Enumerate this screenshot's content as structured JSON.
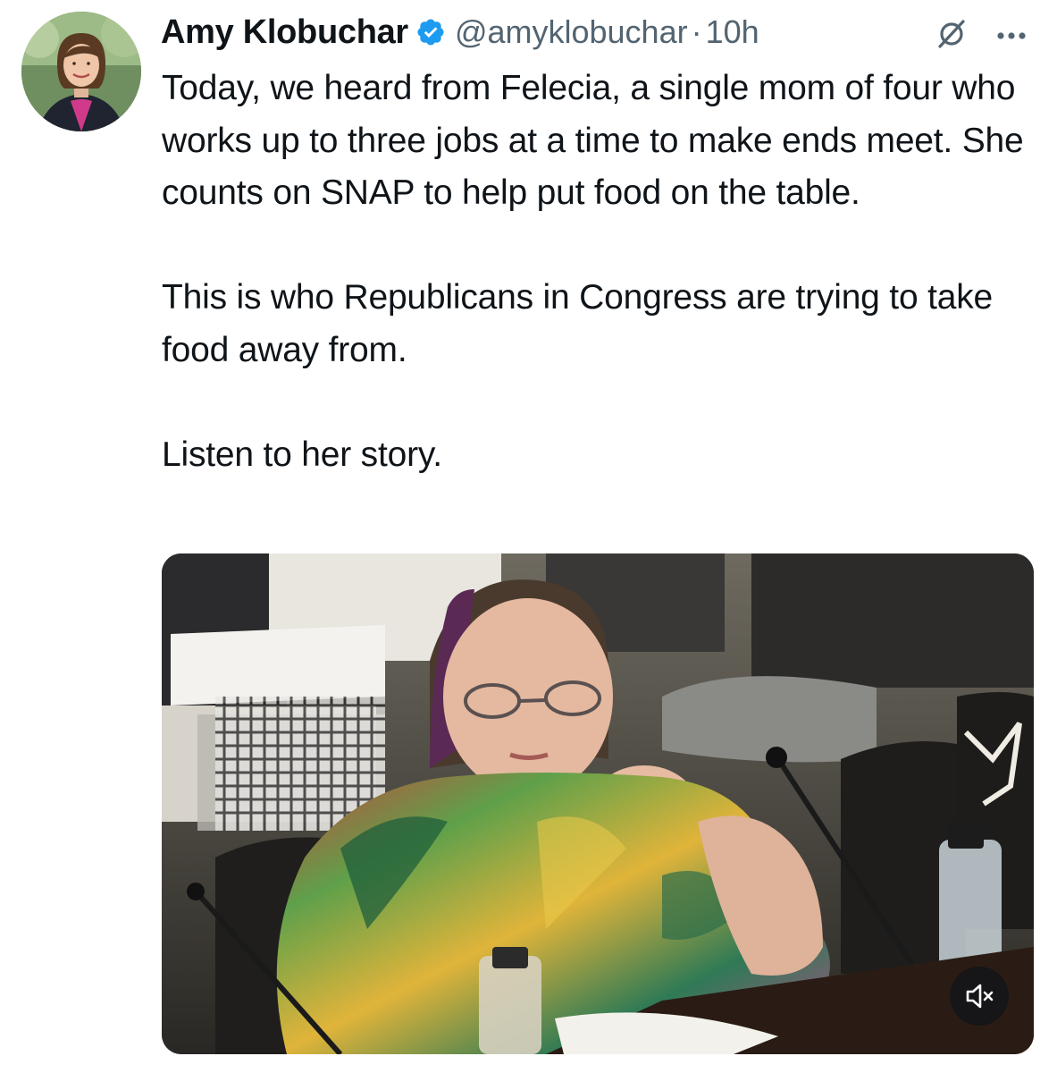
{
  "tweet": {
    "author": {
      "display_name": "Amy Klobuchar",
      "handle": "@amyklobuchar",
      "verified_icon": "verified-badge-icon"
    },
    "separator": "·",
    "timestamp": "10h",
    "paragraphs": [
      "Today, we heard from Felecia, a single mom of four who works up to three jobs at a time to make ends meet. She counts on SNAP to help put food on the table.",
      "This is who Republicans in Congress are trying to take food away from.",
      "Listen to her story."
    ],
    "media": {
      "type": "video",
      "controls": {
        "mute_icon": "volume-muted-icon"
      }
    }
  },
  "colors": {
    "text_primary": "#0f1419",
    "text_secondary": "#536471",
    "verified_blue": "#1d9bf0",
    "background": "#ffffff"
  }
}
